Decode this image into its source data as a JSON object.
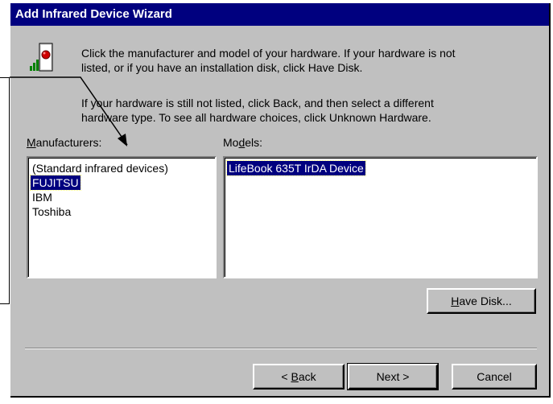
{
  "window": {
    "title": "Add Infrared Device Wizard"
  },
  "instructions": {
    "line1": "Click the manufacturer and model of your hardware. If your hardware is not",
    "line2": "listed, or if you have an installation disk, click Have Disk.",
    "line3": "If your hardware is still not listed, click Back, and then select a different",
    "line4": "hardware type. To see all hardware choices, click Unknown Hardware."
  },
  "manufacturers": {
    "label_prefix": "M",
    "label_rest": "anufacturers:",
    "items": [
      {
        "label": "(Standard infrared devices)",
        "selected": false
      },
      {
        "label": "FUJITSU",
        "selected": true
      },
      {
        "label": "IBM",
        "selected": false
      },
      {
        "label": "Toshiba",
        "selected": false
      }
    ]
  },
  "models": {
    "label_pre": "Mo",
    "label_acc": "d",
    "label_post": "els:",
    "items": [
      {
        "label": "LifeBook 635T IrDA Device",
        "selected": true
      }
    ]
  },
  "buttons": {
    "have_disk_acc": "H",
    "have_disk_rest": "ave Disk...",
    "back_pre": "< ",
    "back_acc": "B",
    "back_rest": "ack",
    "next": "Next >",
    "cancel": "Cancel"
  },
  "icons": {
    "wizard": "infrared-device-icon"
  },
  "colors": {
    "title_bg": "#00007f",
    "selection": "#00007f",
    "face": "#c0c0c0"
  }
}
